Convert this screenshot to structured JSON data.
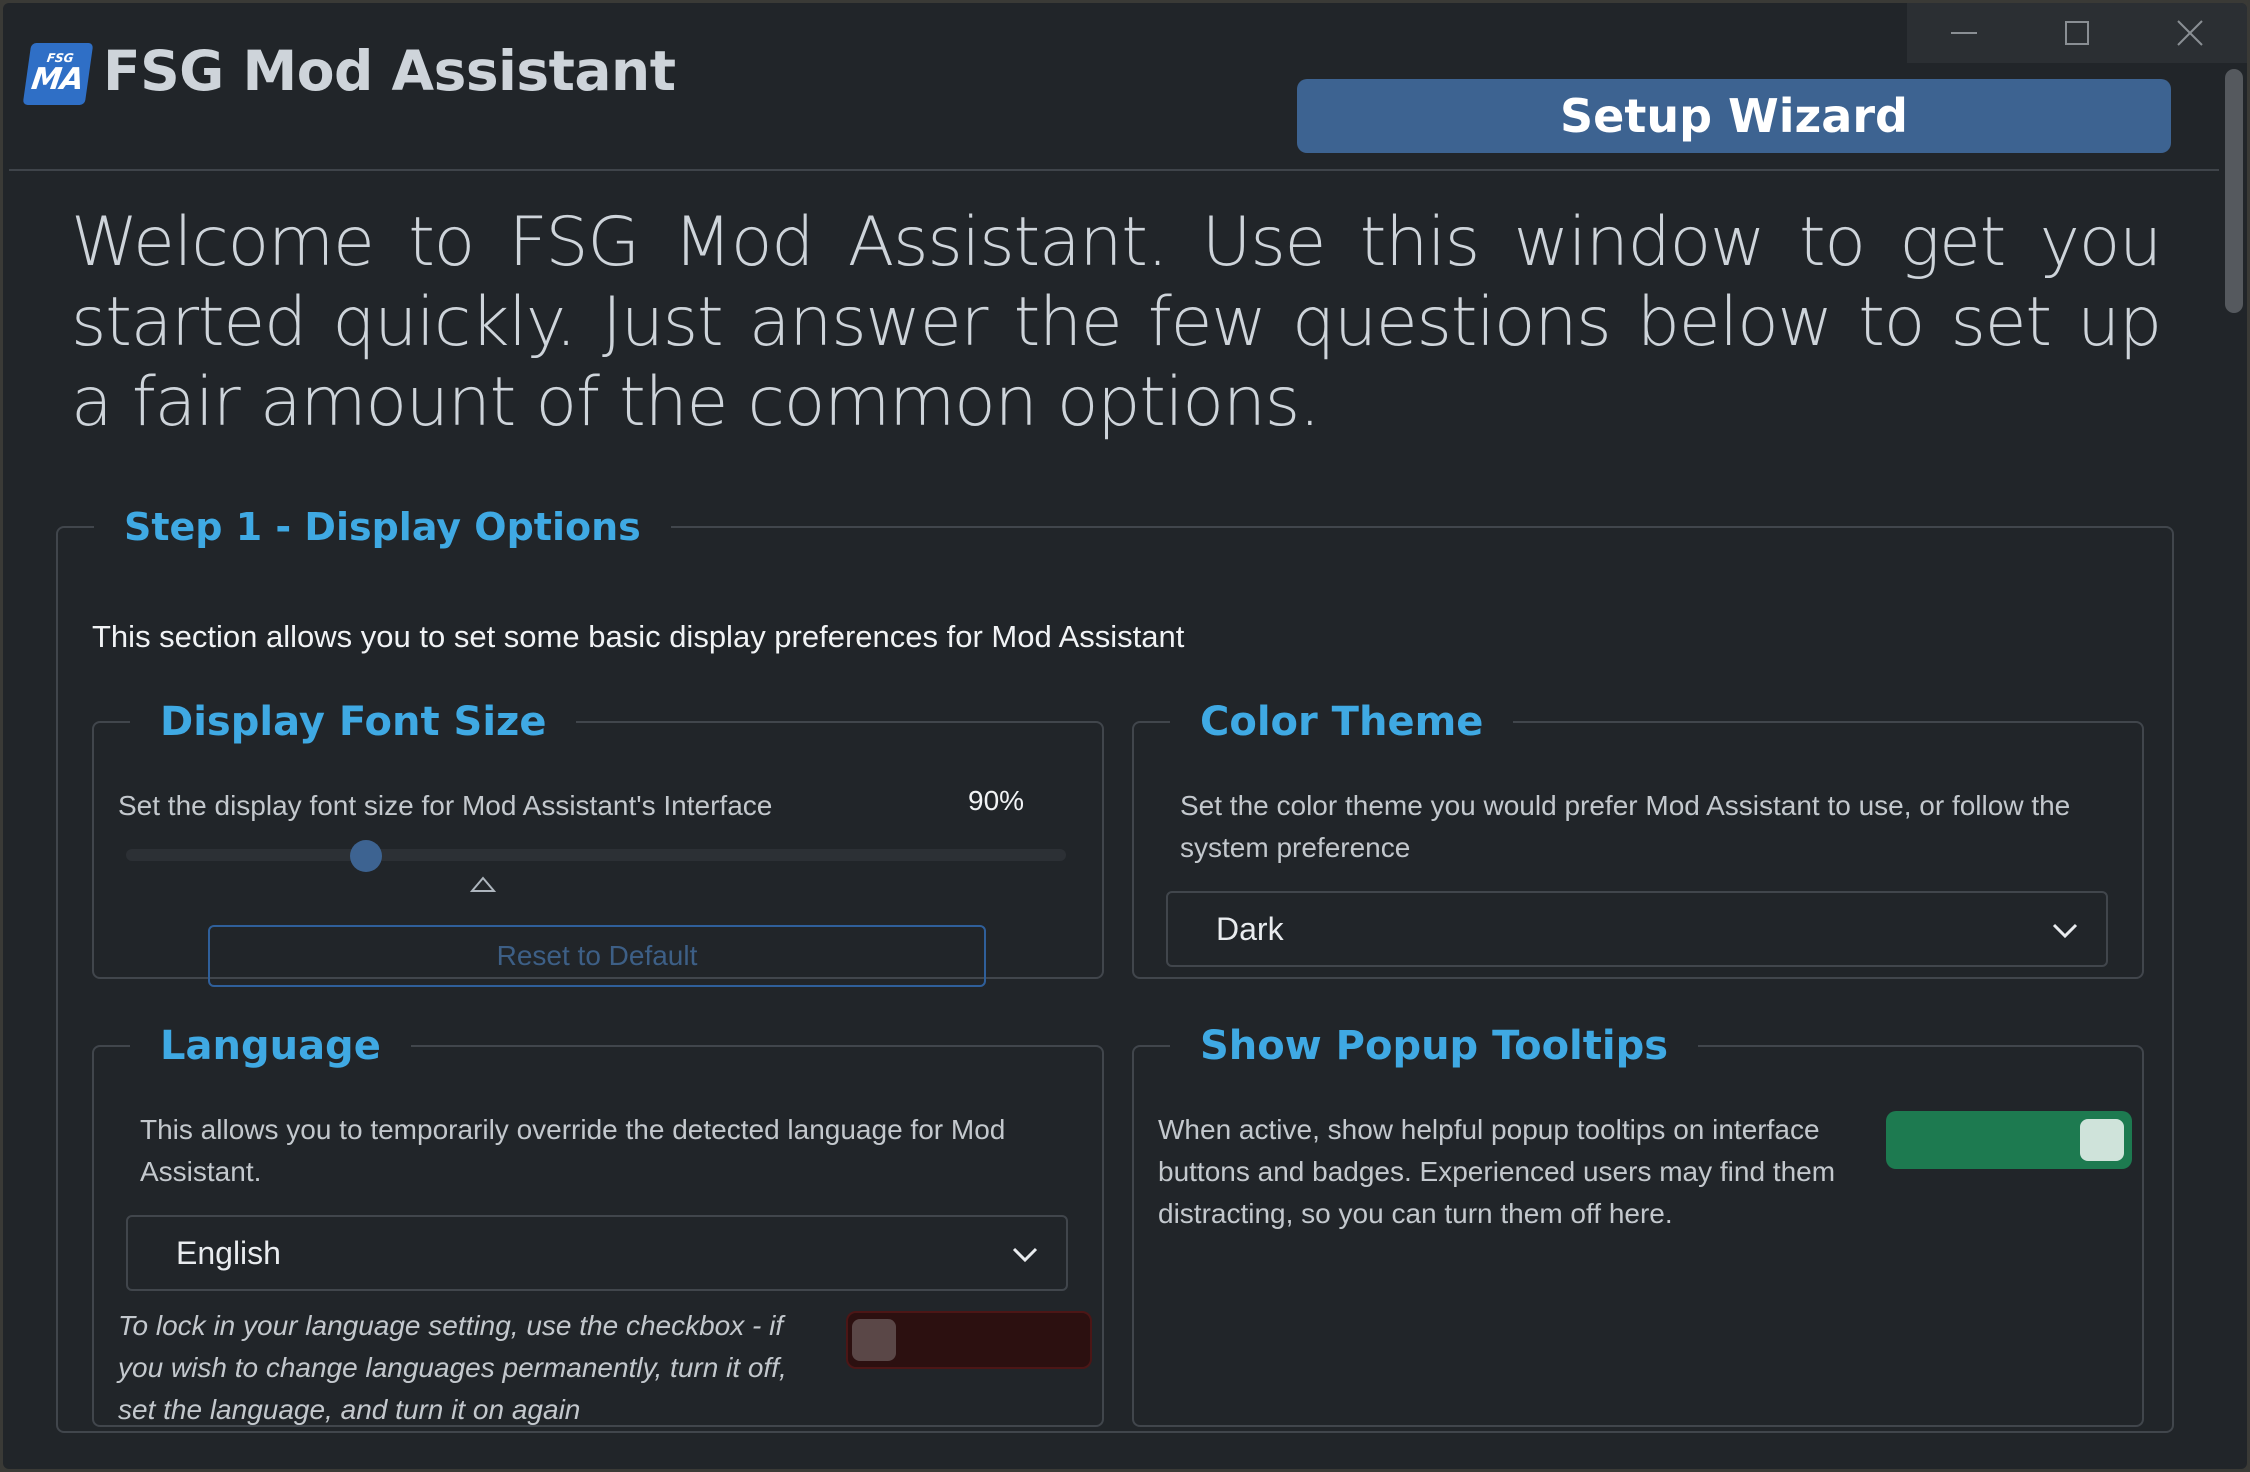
{
  "app": {
    "logo_small": "FSG",
    "logo_big": "MA",
    "title": "FSG Mod Assistant",
    "window_buttons": [
      "minimize-icon",
      "maximize-icon",
      "close-icon"
    ]
  },
  "header": {
    "wizard_label": "Setup Wizard"
  },
  "intro": "Welcome to FSG Mod Assistant. Use this window to get you started quickly. Just answer the few questions below to set up a fair amount of the common options.",
  "step1": {
    "legend": "Step 1 - Display Options",
    "description": "This section allows you to set some basic display preferences for Mod Assistant",
    "font_size": {
      "legend": "Display Font Size",
      "label": "Set the display font size for Mod Assistant's Interface",
      "value": "90%",
      "reset_label": "Reset to Default"
    },
    "color_theme": {
      "legend": "Color Theme",
      "description": "Set the color theme you would prefer Mod Assistant to use, or follow the system preference",
      "selected": "Dark"
    },
    "language": {
      "legend": "Language",
      "description": "This allows you to temporarily override the detected language for Mod Assistant.",
      "selected": "English",
      "lock_note": "To lock in your language setting, use the checkbox - if you wish to change languages permanently, turn it off, set the language, and turn it on again",
      "lock_enabled": false
    },
    "tooltips": {
      "legend": "Show Popup Tooltips",
      "description": "When active, show helpful popup tooltips on interface buttons and badges. Experienced users may find them distracting, so you can turn them off here.",
      "enabled": true
    }
  },
  "colors": {
    "background": "#212529",
    "accent": "#3fa9e3",
    "primary_button": "#3d6391",
    "toggle_on": "#1d7a50",
    "toggle_off": "#2c1010"
  }
}
